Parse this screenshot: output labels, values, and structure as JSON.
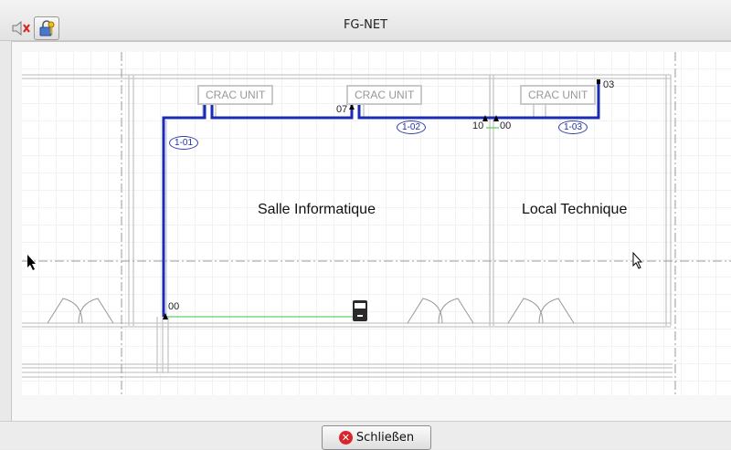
{
  "window": {
    "title": "FG-NET"
  },
  "toolbar_icons": [
    "speaker-muted-icon",
    "lock-key-icon"
  ],
  "floorplan": {
    "rooms": [
      "Salle Informatique",
      "Local Technique"
    ],
    "crac_units": [
      "CRAC UNIT",
      "CRAC UNIT",
      "CRAC UNIT"
    ],
    "zones": [
      "1-01",
      "1-02",
      "1-03"
    ],
    "nodes": [
      "00",
      "07",
      "10",
      "00",
      "03"
    ],
    "detector_icon": "detector-panel-icon",
    "colors": {
      "cable": "#1b2bb5",
      "link": "#5fd35f",
      "grid": "#e6e6e6"
    }
  },
  "footer": {
    "close_label": "Schließen",
    "close_icon": "close-icon"
  }
}
